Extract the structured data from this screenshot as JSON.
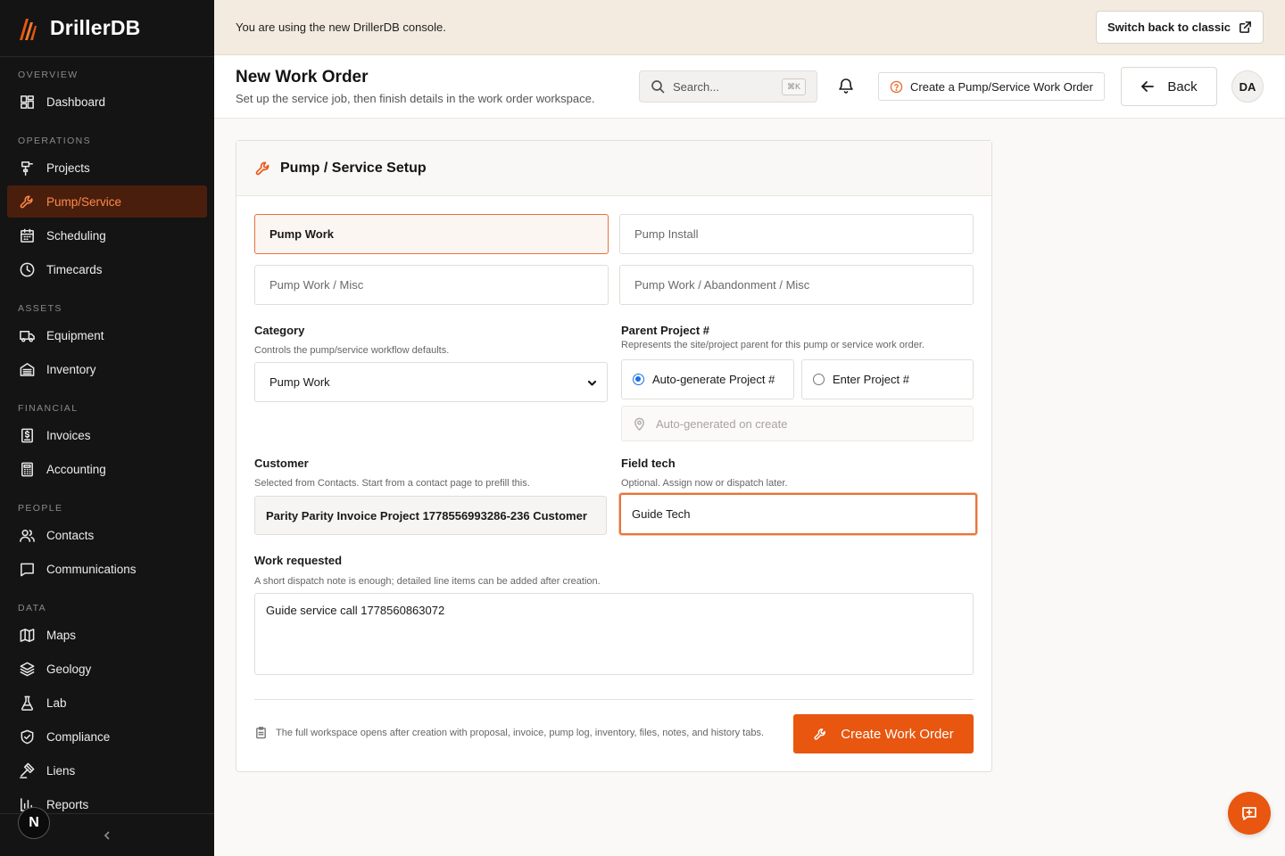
{
  "brand": {
    "name": "DrillerDB",
    "accent": "#e8560f"
  },
  "sidebar": {
    "sections": [
      {
        "title": "OVERVIEW",
        "items": [
          {
            "label": "Dashboard",
            "icon": "dashboard-icon"
          }
        ]
      },
      {
        "title": "OPERATIONS",
        "items": [
          {
            "label": "Projects",
            "icon": "drill-rig-icon"
          },
          {
            "label": "Pump/Service",
            "icon": "wrench-icon",
            "active": true
          },
          {
            "label": "Scheduling",
            "icon": "calendar-icon"
          },
          {
            "label": "Timecards",
            "icon": "clock-icon"
          }
        ]
      },
      {
        "title": "ASSETS",
        "items": [
          {
            "label": "Equipment",
            "icon": "truck-icon"
          },
          {
            "label": "Inventory",
            "icon": "warehouse-icon"
          }
        ]
      },
      {
        "title": "FINANCIAL",
        "items": [
          {
            "label": "Invoices",
            "icon": "invoice-icon"
          },
          {
            "label": "Accounting",
            "icon": "calculator-icon"
          }
        ]
      },
      {
        "title": "PEOPLE",
        "items": [
          {
            "label": "Contacts",
            "icon": "users-icon"
          },
          {
            "label": "Communications",
            "icon": "message-icon"
          }
        ]
      },
      {
        "title": "DATA",
        "items": [
          {
            "label": "Maps",
            "icon": "map-icon"
          },
          {
            "label": "Geology",
            "icon": "layers-icon"
          },
          {
            "label": "Lab",
            "icon": "flask-icon"
          },
          {
            "label": "Compliance",
            "icon": "shield-icon"
          },
          {
            "label": "Liens",
            "icon": "gavel-icon"
          },
          {
            "label": "Reports",
            "icon": "bar-chart-icon"
          }
        ]
      }
    ],
    "footer_avatar": "N"
  },
  "banner": {
    "text": "You are using the new DrillerDB console.",
    "switch_label": "Switch back to classic"
  },
  "header": {
    "title": "New Work Order",
    "subtitle": "Set up the service job, then finish details in the work order workspace.",
    "search_placeholder": "Search...",
    "search_shortcut": "⌘K",
    "create_pump_label": "Create a Pump/Service Work Order",
    "back_label": "Back",
    "avatar_initials": "DA"
  },
  "form": {
    "card_title": "Pump / Service Setup",
    "type_options": [
      "Pump Work",
      "Pump Install",
      "Pump Work / Misc",
      "Pump Work / Abandonment / Misc"
    ],
    "selected_type": "Pump Work",
    "category": {
      "label": "Category",
      "help": "Controls the pump/service workflow defaults.",
      "value": "Pump Work"
    },
    "parent_project": {
      "label": "Parent Project #",
      "help": "Represents the site/project parent for this pump or service work order.",
      "option_auto": "Auto-generate Project #",
      "option_enter": "Enter Project #",
      "selected": "auto",
      "placeholder": "Auto-generated on create"
    },
    "customer": {
      "label": "Customer",
      "help": "Selected from Contacts. Start from a contact page to prefill this.",
      "value": "Parity Parity Invoice Project 1778556993286-236 Customer"
    },
    "field_tech": {
      "label": "Field tech",
      "help": "Optional. Assign now or dispatch later.",
      "value": "Guide Tech"
    },
    "work_requested": {
      "label": "Work requested",
      "help": "A short dispatch note is enough; detailed line items can be added after creation.",
      "value": "Guide service call 1778560863072"
    },
    "footer_note": "The full workspace opens after creation with proposal, invoice, pump log, inventory, files, notes, and history tabs.",
    "submit_label": "Create Work Order"
  }
}
